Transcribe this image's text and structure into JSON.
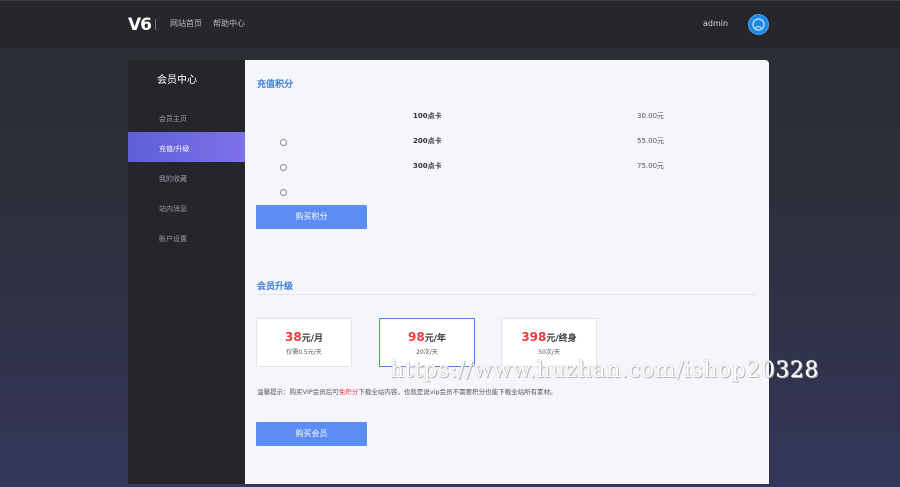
{
  "header": {
    "logo": "V6",
    "nav": [
      "网站首页",
      "帮助中心"
    ],
    "username": "admin"
  },
  "sidebar": {
    "title": "会员中心",
    "items": [
      {
        "label": "会员主页",
        "active": false
      },
      {
        "label": "充值/升级",
        "active": true
      },
      {
        "label": "我的收藏",
        "active": false
      },
      {
        "label": "站内消息",
        "active": false
      },
      {
        "label": "账户设置",
        "active": false
      }
    ]
  },
  "recharge": {
    "title": "充值积分",
    "packages": [
      {
        "name": "100点卡",
        "price": "30.00元"
      },
      {
        "name": "200点卡",
        "price": "55.00元"
      },
      {
        "name": "300点卡",
        "price": "75.00元"
      }
    ],
    "buy_label": "购买积分"
  },
  "upgrade": {
    "title": "会员升级",
    "plans": [
      {
        "amount": "38",
        "unit": "元/月",
        "note": "仅需0.5元/天",
        "selected": false
      },
      {
        "amount": "98",
        "unit": "元/年",
        "note": "20次/天",
        "selected": true
      },
      {
        "amount": "398",
        "unit": "元/终身",
        "note": "50次/天",
        "selected": false
      }
    ],
    "notice_prefix": "温馨提示：购买VIP会员后可",
    "notice_highlight": "免积分",
    "notice_suffix": "下载全站内容，也就是说vip会员不需要积分也能下载全站所有素材。",
    "buy_label": "购买会员"
  },
  "watermark": "https://www.huzhan.com/ishop20328",
  "colors": {
    "accent": "#5b8df5",
    "price_red": "#ef3b3b",
    "title_blue": "#3b7ad8",
    "active_item": "#6b66e0"
  }
}
